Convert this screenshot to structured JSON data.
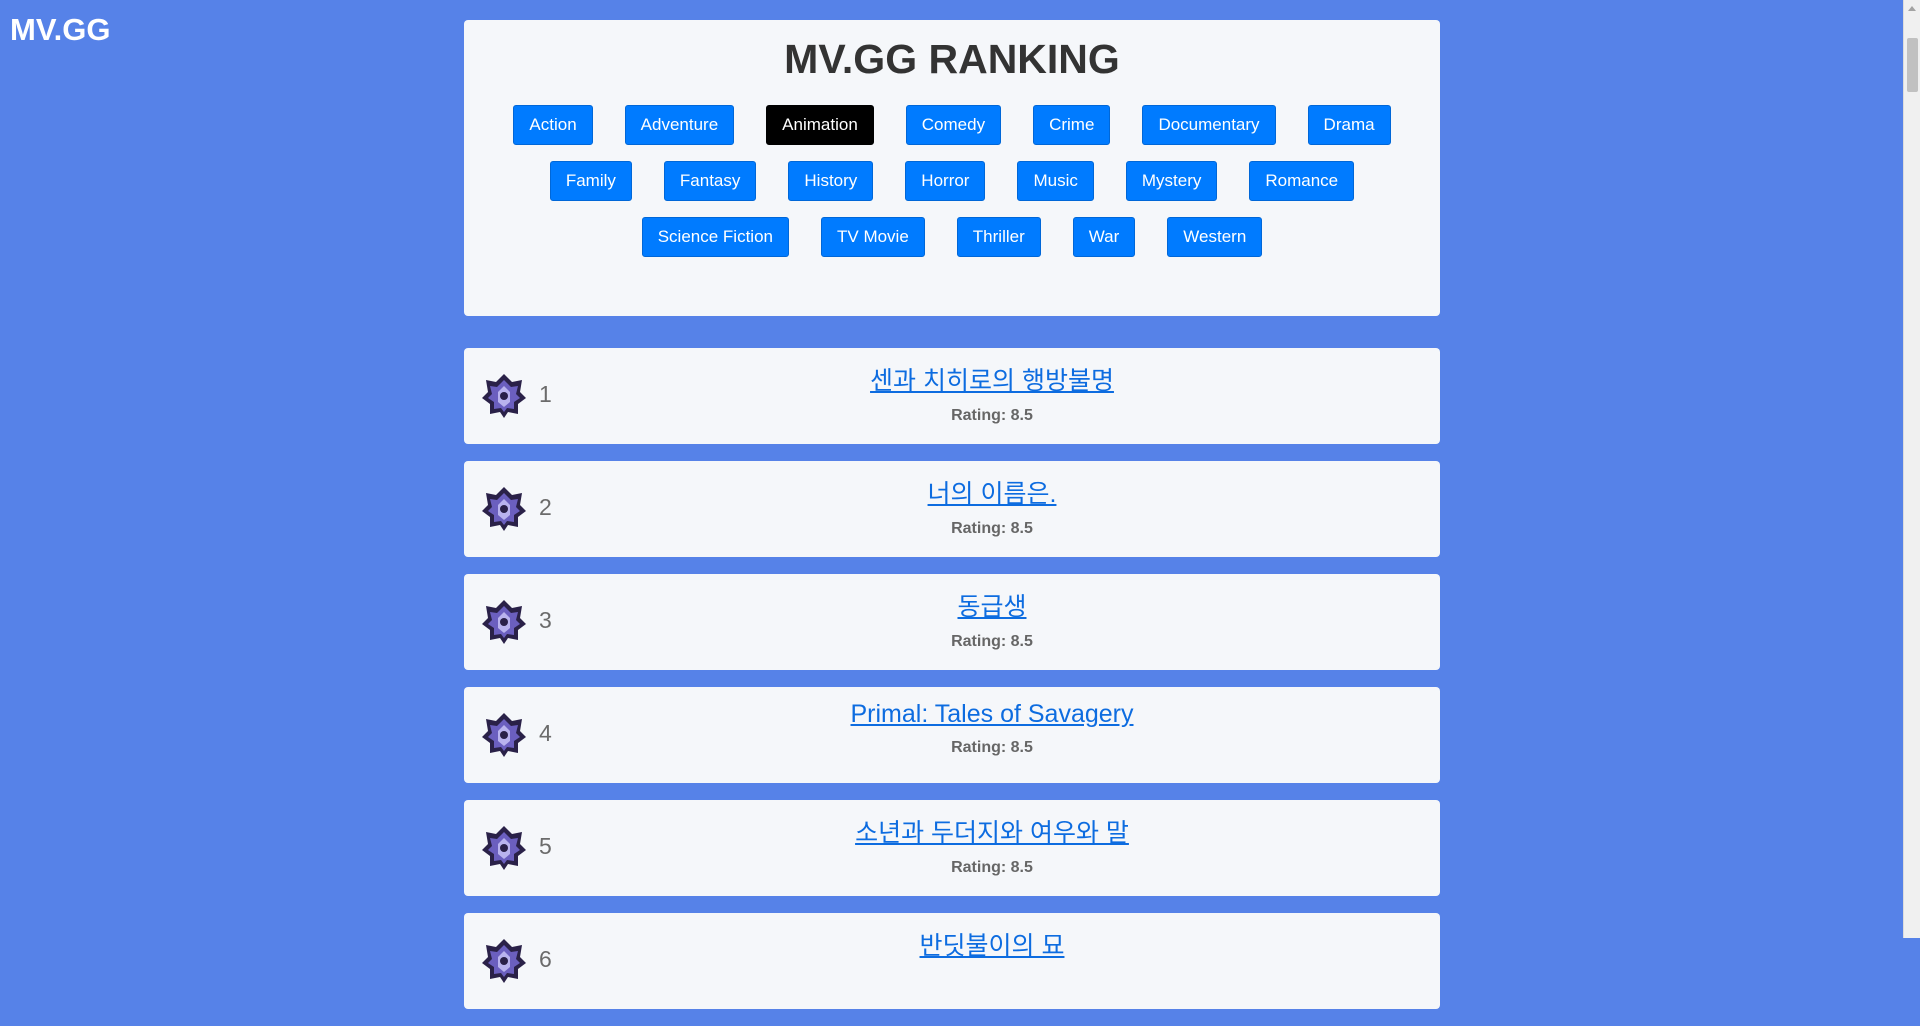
{
  "brand": "MV.GG",
  "header": {
    "title": "MV.GG RANKING"
  },
  "genres": {
    "row1": [
      "Action",
      "Adventure",
      "Animation",
      "Comedy",
      "Crime",
      "Documentary",
      "Drama"
    ],
    "row2": [
      "Family",
      "Fantasy",
      "History",
      "Horror",
      "Music",
      "Mystery",
      "Romance"
    ],
    "row3": [
      "Science Fiction",
      "TV Movie",
      "Thriller",
      "War",
      "Western"
    ],
    "active": "Animation"
  },
  "movies": [
    {
      "rank": "1",
      "title": "센과 치히로의 행방불명",
      "rating": "Rating: 8.5",
      "icon": "rank-emblem-icon"
    },
    {
      "rank": "2",
      "title": "너의 이름은.",
      "rating": "Rating: 8.5",
      "icon": "rank-emblem-icon"
    },
    {
      "rank": "3",
      "title": "동급생",
      "rating": "Rating: 8.5",
      "icon": "rank-emblem-icon"
    },
    {
      "rank": "4",
      "title": "Primal: Tales of Savagery",
      "rating": "Rating: 8.5",
      "icon": "rank-emblem-icon"
    },
    {
      "rank": "5",
      "title": "소년과 두더지와 여우와 말",
      "rating": "Rating: 8.5",
      "icon": "rank-emblem-icon"
    },
    {
      "rank": "6",
      "title": "반딧불이의 묘",
      "rating": "",
      "icon": "rank-emblem-icon"
    }
  ],
  "colors": {
    "background": "#5682e8",
    "card": "#f5f7fa",
    "button": "#007bff",
    "active_button": "#000000",
    "link": "#0d6ce0"
  }
}
